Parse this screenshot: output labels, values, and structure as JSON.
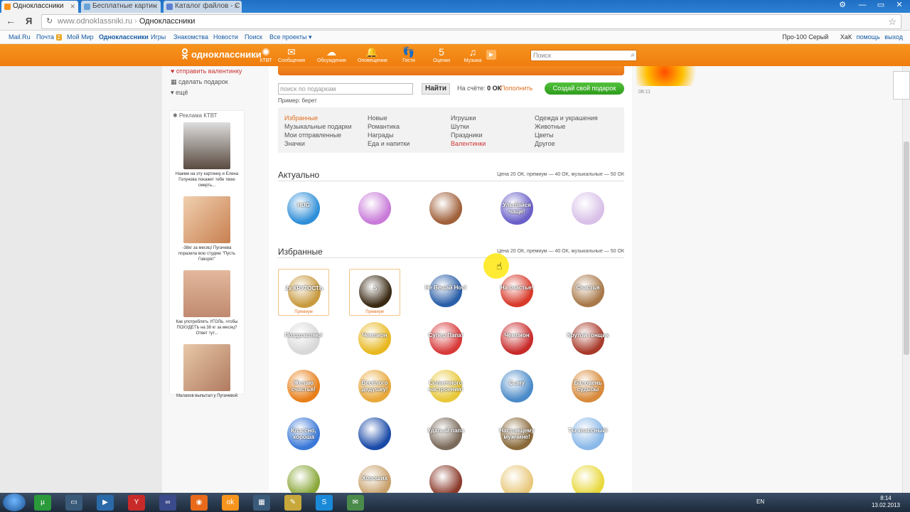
{
  "browser": {
    "tabs": [
      {
        "label": "Одноклассники",
        "active": true,
        "color": "#f7941d"
      },
      {
        "label": "Бесплатные картин",
        "active": false,
        "color": "#6aa2d8"
      },
      {
        "label": "Каталог файлов - С",
        "active": false,
        "color": "#5b7fd1"
      }
    ],
    "url": "www.odnoklassniki.ru",
    "breadcrumb": "Одноклассники"
  },
  "mailbar": {
    "items": [
      "Mail.Ru",
      "Почта",
      "Мой Мир",
      "Одноклассники",
      "Игры",
      "Знакомства",
      "Новости",
      "Поиск",
      "Все проекты ▾"
    ],
    "mail_count": "2",
    "user": "Про-100 Серый",
    "user2": "ХаК",
    "help": "помощь",
    "logout": "выход"
  },
  "okhead": {
    "logo": "одноклассники",
    "nav": [
      {
        "label": "КТВТ",
        "icon": "✺"
      },
      {
        "label": "Сообщения",
        "icon": "✉"
      },
      {
        "label": "Обсуждения",
        "icon": "☁"
      },
      {
        "label": "Оповещения",
        "icon": "🔔"
      },
      {
        "label": "Гости",
        "icon": "👣"
      },
      {
        "label": "Оценки",
        "icon": "5"
      },
      {
        "label": "Музыка",
        "icon": "♫"
      }
    ],
    "search_placeholder": "Поиск"
  },
  "sidebar": {
    "links": [
      "отправить валентинку",
      "сделать подарок",
      "ещё"
    ],
    "ad_header": "Реклама КТВТ",
    "ads": [
      {
        "caption": "Нажми на эту картинку и Елена Голунова покажет тебе твою смерть...",
        "color": "#5a4a40"
      },
      {
        "caption": "-38кг за месяц! Пугачева поразила всю студию \"Пусть Говорят\"",
        "color": "#c88050"
      },
      {
        "caption": "Как употреблять УГОЛЬ, чтобы ПОХУДЕТЬ на 38 кг за месяц? Ответ тут...",
        "color": "#e3b89c"
      },
      {
        "caption": "Малахов выпытал у Пугачевой",
        "color": "#b07a60"
      }
    ]
  },
  "gifts": {
    "search_placeholder": "поиск по подаркам",
    "find_label": "Найти",
    "balance_label": "На счёте:",
    "balance_value": "0 ОК",
    "refill_label": "Пополнить",
    "create_label": "Создай свой подарок",
    "example": "Пример: берет",
    "categories": [
      [
        "Избранные",
        "Музыкальные подарки",
        "Мои отправленные",
        "Значки"
      ],
      [
        "Новые",
        "Романтика",
        "Награды",
        "Еда и напитки"
      ],
      [
        "Игрушки",
        "Шутки",
        "Праздники",
        "Валентинки"
      ],
      [
        "Одежда и украшения",
        "Животные",
        "Цветы",
        "Другое"
      ]
    ],
    "sections": [
      {
        "title": "Актуально",
        "price": "Цена 20 ОК, премиум — 40 ОК, музыкальные — 50 ОК"
      },
      {
        "title": "Избранные",
        "price": "Цена 20 ОК, премиум — 40 ОК, музыкальные — 50 ОК"
      }
    ],
    "actual": [
      {
        "caption": "HUG",
        "color": "#2f8fd8"
      },
      {
        "caption": "",
        "color": "#c87ad8"
      },
      {
        "caption": "",
        "color": "#a0603a"
      },
      {
        "caption": "Улыбайся чаще!",
        "color": "#6a60c8"
      },
      {
        "caption": "",
        "color": "#d8c0e8"
      }
    ],
    "favorites": [
      {
        "caption": "2x КРУТОСТЬ",
        "color": "#c89a40",
        "premium": true,
        "premium_label": "Премиум"
      },
      {
        "caption": "$",
        "color": "#3a2a14",
        "premium": true,
        "premium_label": "Премиум"
      },
      {
        "caption": "Не Вешай Нос!",
        "color": "#2a5ea8",
        "premium": false
      },
      {
        "caption": "На счастье!",
        "color": "#d83a2a",
        "premium": false
      },
      {
        "caption": "Счастья",
        "color": "#a87848",
        "premium": false
      },
      {
        "caption": "Поздравляю!",
        "color": "#d8d8d8",
        "premium": false
      },
      {
        "caption": "Чемпион",
        "color": "#e8b820",
        "premium": false
      },
      {
        "caption": "Супер Папа!",
        "color": "#d83a3a",
        "premium": false
      },
      {
        "caption": "Чемпион",
        "color": "#c82a2a",
        "premium": false
      },
      {
        "caption": "Крутой гонщик",
        "color": "#a83a2a",
        "premium": false
      },
      {
        "caption": "Желаю счастья!",
        "color": "#e8801a",
        "premium": false
      },
      {
        "caption": "Весёлого дедушку!",
        "color": "#e8a83a",
        "premium": false
      },
      {
        "caption": "Солнечного настроения!",
        "color": "#e8c83a",
        "premium": false
      },
      {
        "caption": "Сыну",
        "color": "#4a8ac8",
        "premium": false
      },
      {
        "caption": "Баловень судьбы",
        "color": "#d88a3a",
        "premium": false
      },
      {
        "caption": "Классно, хороша",
        "color": "#3a78d8",
        "premium": false
      },
      {
        "caption": "",
        "color": "#1a4aa8",
        "premium": false
      },
      {
        "caption": "Удалый папа",
        "color": "#7a6a5a",
        "premium": false
      },
      {
        "caption": "Настоящему мужчине!",
        "color": "#8a6a3a",
        "premium": false
      },
      {
        "caption": "Ты классный!",
        "color": "#8ab8e8",
        "premium": false
      },
      {
        "caption": "",
        "color": "#8aa83a",
        "premium": false
      },
      {
        "caption": "Хороших",
        "color": "#c8a06a",
        "premium": false
      },
      {
        "caption": "",
        "color": "#8a3a2a",
        "premium": false
      },
      {
        "caption": "",
        "color": "#e8c87a",
        "premium": false
      },
      {
        "caption": "",
        "color": "#e8d83a",
        "premium": false
      }
    ]
  },
  "right": {
    "time": "08:11"
  },
  "taskbar": {
    "lang": "EN",
    "time": "8:14",
    "date": "13.02.2013",
    "apps": [
      "µ",
      "▭",
      "▶",
      "Y",
      "∞",
      "◉",
      "ok",
      "▦",
      "✎",
      "S",
      "✉"
    ]
  },
  "colors": {
    "ok_orange": "#f7941d",
    "accent": "#e07020",
    "green": "#3aa828"
  }
}
